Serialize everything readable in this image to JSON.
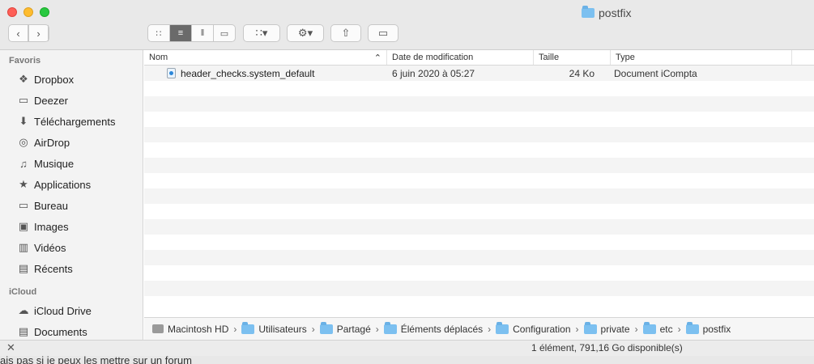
{
  "window": {
    "title": "postfix"
  },
  "toolbar": {
    "back_icon": "chevron-left",
    "forward_icon": "chevron-right",
    "view_icons": [
      "icon-view",
      "list-view",
      "column-view",
      "gallery-view"
    ],
    "group_label": "▾",
    "action_label": "▾"
  },
  "sidebar": {
    "favorites_heading": "Favoris",
    "favorites": [
      {
        "label": "Dropbox",
        "icon": "dropbox-icon"
      },
      {
        "label": "Deezer",
        "icon": "folder-icon"
      },
      {
        "label": "Téléchargements",
        "icon": "download-icon"
      },
      {
        "label": "AirDrop",
        "icon": "airdrop-icon"
      },
      {
        "label": "Musique",
        "icon": "music-icon"
      },
      {
        "label": "Applications",
        "icon": "applications-icon"
      },
      {
        "label": "Bureau",
        "icon": "desktop-icon"
      },
      {
        "label": "Images",
        "icon": "camera-icon"
      },
      {
        "label": "Vidéos",
        "icon": "film-icon"
      },
      {
        "label": "Récents",
        "icon": "recents-icon"
      }
    ],
    "icloud_heading": "iCloud",
    "icloud": [
      {
        "label": "iCloud Drive",
        "icon": "cloud-icon"
      },
      {
        "label": "Documents",
        "icon": "documents-icon"
      }
    ]
  },
  "columns": {
    "name": "Nom",
    "date": "Date de modification",
    "size": "Taille",
    "type": "Type"
  },
  "files": [
    {
      "name": "header_checks.system_default",
      "date": "6 juin 2020 à 05:27",
      "size": "24 Ko",
      "type": "Document iCompta"
    }
  ],
  "pathbar": [
    "Macintosh HD",
    "Utilisateurs",
    "Partagé",
    "Éléments déplacés",
    "Configuration",
    "private",
    "etc",
    "postfix"
  ],
  "status": {
    "text": "1 élément, 791,16 Go disponible(s)"
  },
  "below": {
    "text": "ais pas si je peux les mettre sur un forum"
  }
}
